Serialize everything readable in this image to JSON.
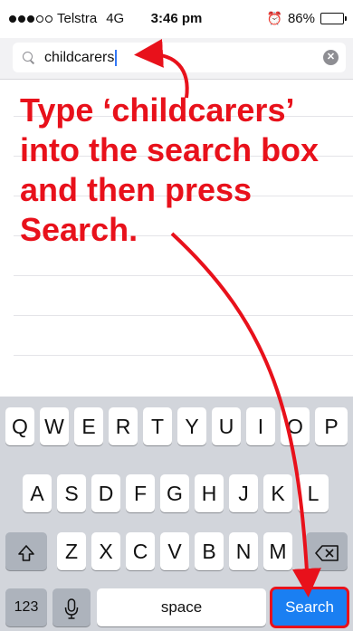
{
  "status_bar": {
    "signal_dots": 5,
    "signal_filled": 3,
    "carrier": "Telstra",
    "network": "4G",
    "time": "3:46 pm",
    "battery_percent": "86%",
    "battery_level": 0.86
  },
  "search": {
    "value": "childcarers"
  },
  "instruction": {
    "lines": [
      "Type ‘childcarers’",
      "into the search box",
      "and then press",
      "Search."
    ],
    "color": "#e8111b"
  },
  "keyboard": {
    "row1": [
      "Q",
      "W",
      "E",
      "R",
      "T",
      "Y",
      "U",
      "I",
      "O",
      "P"
    ],
    "row2": [
      "A",
      "S",
      "D",
      "F",
      "G",
      "H",
      "J",
      "K",
      "L"
    ],
    "row3": [
      "Z",
      "X",
      "C",
      "V",
      "B",
      "N",
      "M"
    ],
    "numbers_label": "123",
    "space_label": "space",
    "search_label": "Search",
    "search_color": "#1a7ff2"
  },
  "icons": {
    "search": "search-icon",
    "clear": "clear-icon",
    "alarm": "alarm-icon",
    "battery": "battery-icon",
    "shift": "shift-icon",
    "delete": "delete-icon",
    "mic": "microphone-icon"
  }
}
